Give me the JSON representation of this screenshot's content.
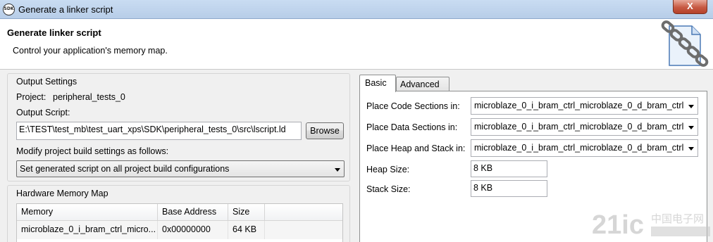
{
  "window": {
    "title": "Generate a linker script",
    "app_icon_text": "SDK",
    "close_glyph": "X"
  },
  "header": {
    "title": "Generate linker script",
    "description": "Control your application's memory map."
  },
  "output_settings": {
    "group_label": "Output Settings",
    "project_label": "Project:",
    "project_value": "peripheral_tests_0",
    "output_script_label": "Output Script:",
    "output_script_value": "E:\\TEST\\test_mb\\test_uart_xps\\SDK\\peripheral_tests_0\\src\\lscript.ld",
    "browse_label": "Browse",
    "modify_label": "Modify project build settings as follows:",
    "modify_selected": "Set generated script on all project build configurations"
  },
  "hardware_memory_map": {
    "group_label": "Hardware Memory Map",
    "columns": [
      "Memory",
      "Base Address",
      "Size"
    ],
    "rows": [
      [
        "microblaze_0_i_bram_ctrl_micro...",
        "0x00000000",
        "64 KB"
      ]
    ]
  },
  "tabs": [
    {
      "label": "Basic",
      "active": true
    },
    {
      "label": "Advanced",
      "active": false
    }
  ],
  "basic": {
    "code_label": "Place Code Sections in:",
    "code_value": "microblaze_0_i_bram_ctrl_microblaze_0_d_bram_ctrl",
    "data_label": "Place Data Sections in:",
    "data_value": "microblaze_0_i_bram_ctrl_microblaze_0_d_bram_ctrl",
    "heap_stack_label": "Place Heap and Stack in:",
    "heap_stack_value": "microblaze_0_i_bram_ctrl_microblaze_0_d_bram_ctrl",
    "heap_size_label": "Heap Size:",
    "heap_size_value": "8 KB",
    "stack_size_label": "Stack Size:",
    "stack_size_value": "8 KB"
  },
  "watermark": {
    "brand": "21ic",
    "text": "中国电子网"
  },
  "colors": {
    "titlebar": "#c9dcf2",
    "close_button": "#c75a43",
    "dialog_bg": "#f0f0f0"
  }
}
